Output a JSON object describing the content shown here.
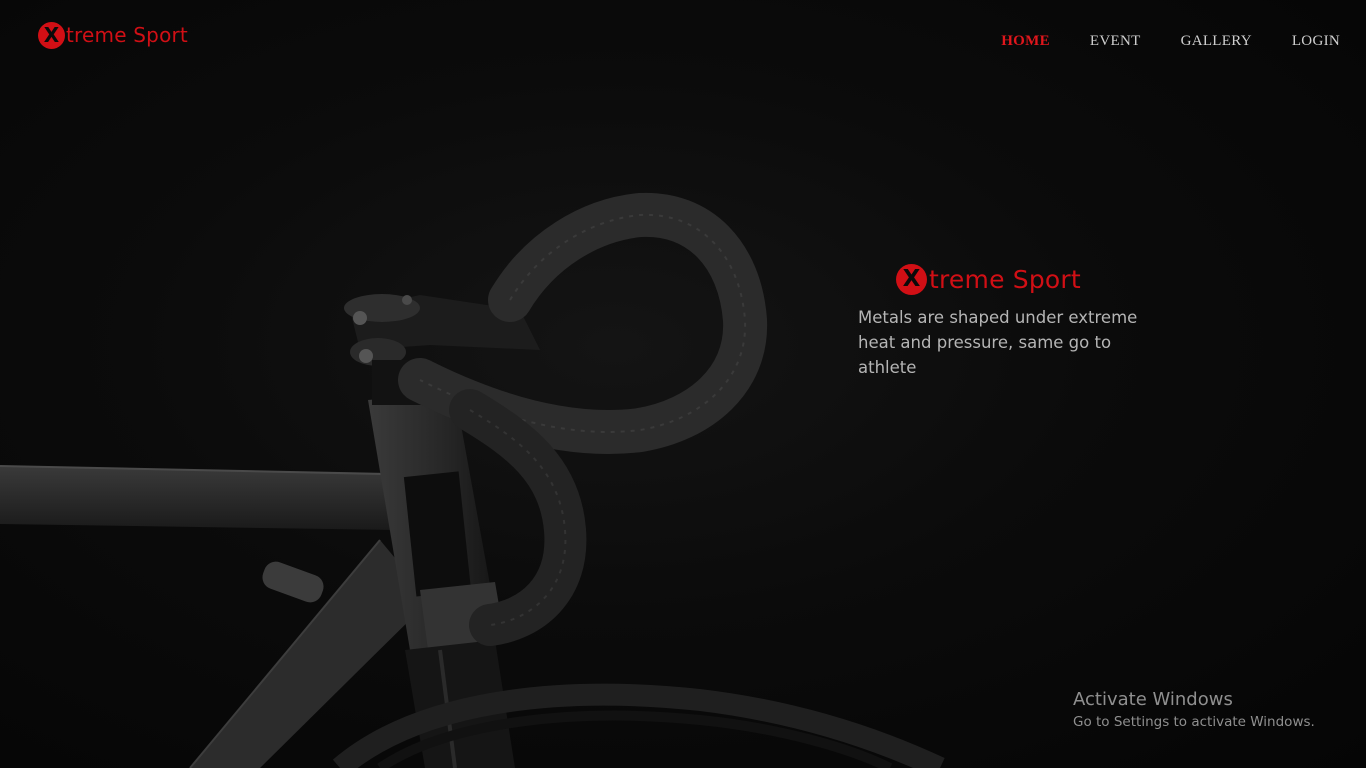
{
  "header": {
    "logo_letter": "X",
    "logo_text": "treme Sport"
  },
  "nav": {
    "items": [
      {
        "label": "HOME",
        "active": true
      },
      {
        "label": "EVENT",
        "active": false
      },
      {
        "label": "GALLERY",
        "active": false
      },
      {
        "label": "LOGIN",
        "active": false
      }
    ]
  },
  "hero": {
    "image": "bicycle-handlebar-photo",
    "brand_letter": "X",
    "brand_text": "treme Sport",
    "tagline": "Metals are shaped under extreme heat and pressure, same go to athlete"
  },
  "watermark": {
    "title": "Activate Windows",
    "subtitle": "Go to Settings to activate Windows."
  },
  "colors": {
    "accent": "#d10f15",
    "background": "#050505",
    "nav_text": "#cfcfcf"
  }
}
